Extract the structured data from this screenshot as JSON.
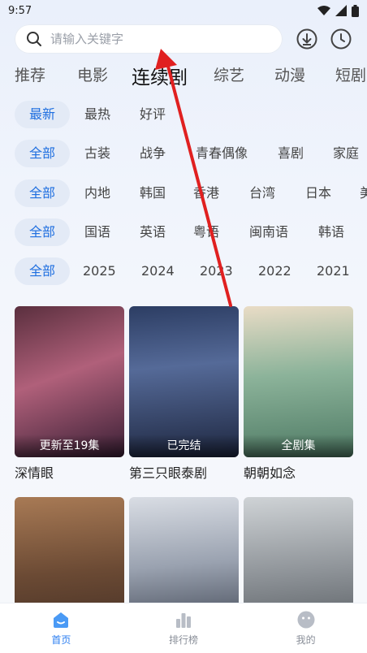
{
  "status": {
    "time": "9:57"
  },
  "search": {
    "placeholder": "请输入关键字"
  },
  "tabs": [
    "推荐",
    "电影",
    "连续剧",
    "综艺",
    "动漫",
    "短剧"
  ],
  "filters": {
    "sort": [
      "最新",
      "最热",
      "好评"
    ],
    "genre": [
      "全部",
      "古装",
      "战争",
      "青春偶像",
      "喜剧",
      "家庭"
    ],
    "region": [
      "全部",
      "内地",
      "韩国",
      "香港",
      "台湾",
      "日本",
      "美"
    ],
    "language": [
      "全部",
      "国语",
      "英语",
      "粤语",
      "闽南语",
      "韩语"
    ],
    "year": [
      "全部",
      "2025",
      "2024",
      "2023",
      "2022",
      "2021"
    ]
  },
  "cards": [
    {
      "title": "深情眼",
      "badge": "更新至19集"
    },
    {
      "title": "第三只眼泰剧",
      "badge": "已完结"
    },
    {
      "title": "朝朝如念",
      "badge": "全剧集"
    },
    {
      "title": "",
      "badge": ""
    },
    {
      "title": "",
      "badge": ""
    },
    {
      "title": "",
      "badge": ""
    }
  ],
  "nav": [
    "首页",
    "排行榜",
    "我的"
  ],
  "colors": {
    "accent": "#2a7df0",
    "arrow": "#e02020"
  }
}
